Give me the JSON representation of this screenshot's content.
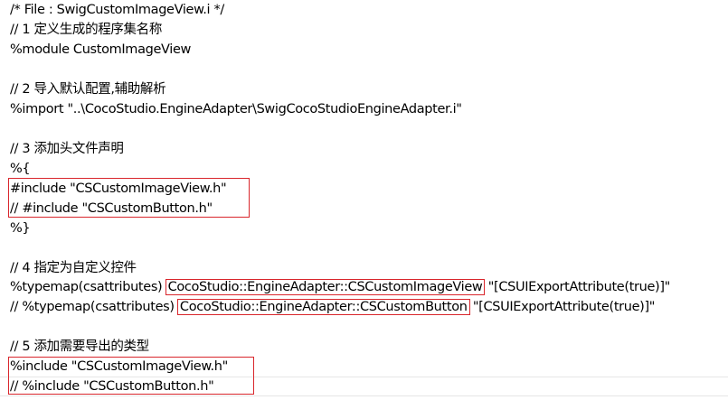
{
  "editor": {
    "lines": [
      "/* File : SwigCustomImageView.i */",
      "// 1 定义生成的程序集名称",
      "%module CustomImageView",
      "",
      "// 2 导入默认配置,辅助解析",
      "%import \"..\\CocoStudio.EngineAdapter\\SwigCocoStudioEngineAdapter.i\"",
      "",
      "// 3 添加头文件声明",
      "%{",
      "#include \"CSCustomImageView.h\"",
      "// #include \"CSCustomButton.h\"",
      "%}",
      "",
      "// 4 指定为自定义控件",
      "%typemap(csattributes) ",
      "CocoStudio::EngineAdapter::CSCustomImageView",
      " \"[CSUIExportAttribute(true)]\"",
      "// %typemap(csattributes) ",
      "CocoStudio::EngineAdapter::CSCustomButton",
      " \"[CSUIExportAttribute(true)]\"",
      "",
      "// 5 添加需要导出的类型",
      "%include \"CSCustomImageView.h\"",
      "// %include \"CSCustomButton.h\""
    ]
  },
  "colors": {
    "highlight_border": "#d9262c",
    "text": "#000000",
    "background": "#ffffff"
  }
}
